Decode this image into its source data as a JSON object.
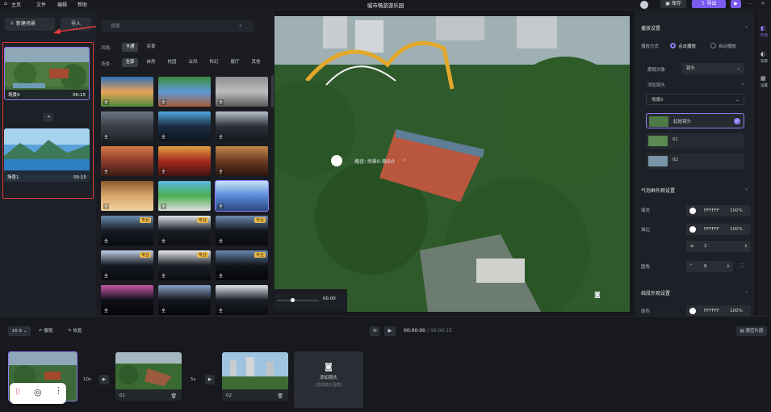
{
  "topbar": {
    "home": "主页",
    "menus": [
      "文件",
      "编辑",
      "帮助"
    ],
    "title": "城市畅游游乐园",
    "save": "保存",
    "export": "导出"
  },
  "left_panel": {
    "add_scene": "新建场景",
    "import": "导入",
    "scenes": [
      {
        "label": "场景0",
        "duration": "00:15"
      },
      {
        "label": "场景1",
        "duration": "00:15"
      }
    ]
  },
  "resources": {
    "search_placeholder": "搜索",
    "style_label": "风格:",
    "styles": [
      "卡通",
      "实景"
    ],
    "type_label": "场景:",
    "types": [
      "全部",
      "自然",
      "校园",
      "古风",
      "科幻",
      "展厅",
      "其他"
    ],
    "tags": {
      "quanjing": "全",
      "pro": "专业"
    }
  },
  "preview": {
    "camera_path": "路径: 场景0-镜头0",
    "time": "00.00"
  },
  "right_panel": {
    "section_title": "播放设置",
    "play_mode_label": "播放方式",
    "play_modes": [
      "点击播放",
      "自动播放"
    ],
    "target_label": "跟随对象",
    "target_value": "镜头",
    "add_camera_label": "添加镜头",
    "scene_select": "场景0",
    "cameras": [
      "起始镜头",
      "01",
      "02"
    ],
    "bubble_section": "气泡框外观设置",
    "fill_label": "填充",
    "fill_color": "FFFFFF",
    "fill_opacity": "100%",
    "border_label": "描边",
    "border_color": "FFFFFF",
    "border_opacity": "100%",
    "border_width": "2",
    "radius_label": "圆角",
    "radius_value": "8",
    "line_section": "线段外观设置",
    "line_color_label": "颜色",
    "line_color": "FFFFFF",
    "line_opacity": "100%",
    "side_tabs": [
      "外观",
      "背景",
      "设置"
    ]
  },
  "timeline": {
    "ratio": "16:9",
    "undo": "撤销",
    "redo": "恢复",
    "time_current": "00:00:00",
    "time_total": "00:00:15",
    "clear": "清空片段",
    "clips": [
      {
        "name": "01"
      },
      {
        "name": "02"
      }
    ],
    "transitions": [
      "10s",
      "5s"
    ],
    "add_camera": "添加镜头",
    "add_camera_hint": "(选择镜头视角)"
  },
  "colors": {
    "accent": "#7a5cf0",
    "highlight": "#e03a3a"
  }
}
